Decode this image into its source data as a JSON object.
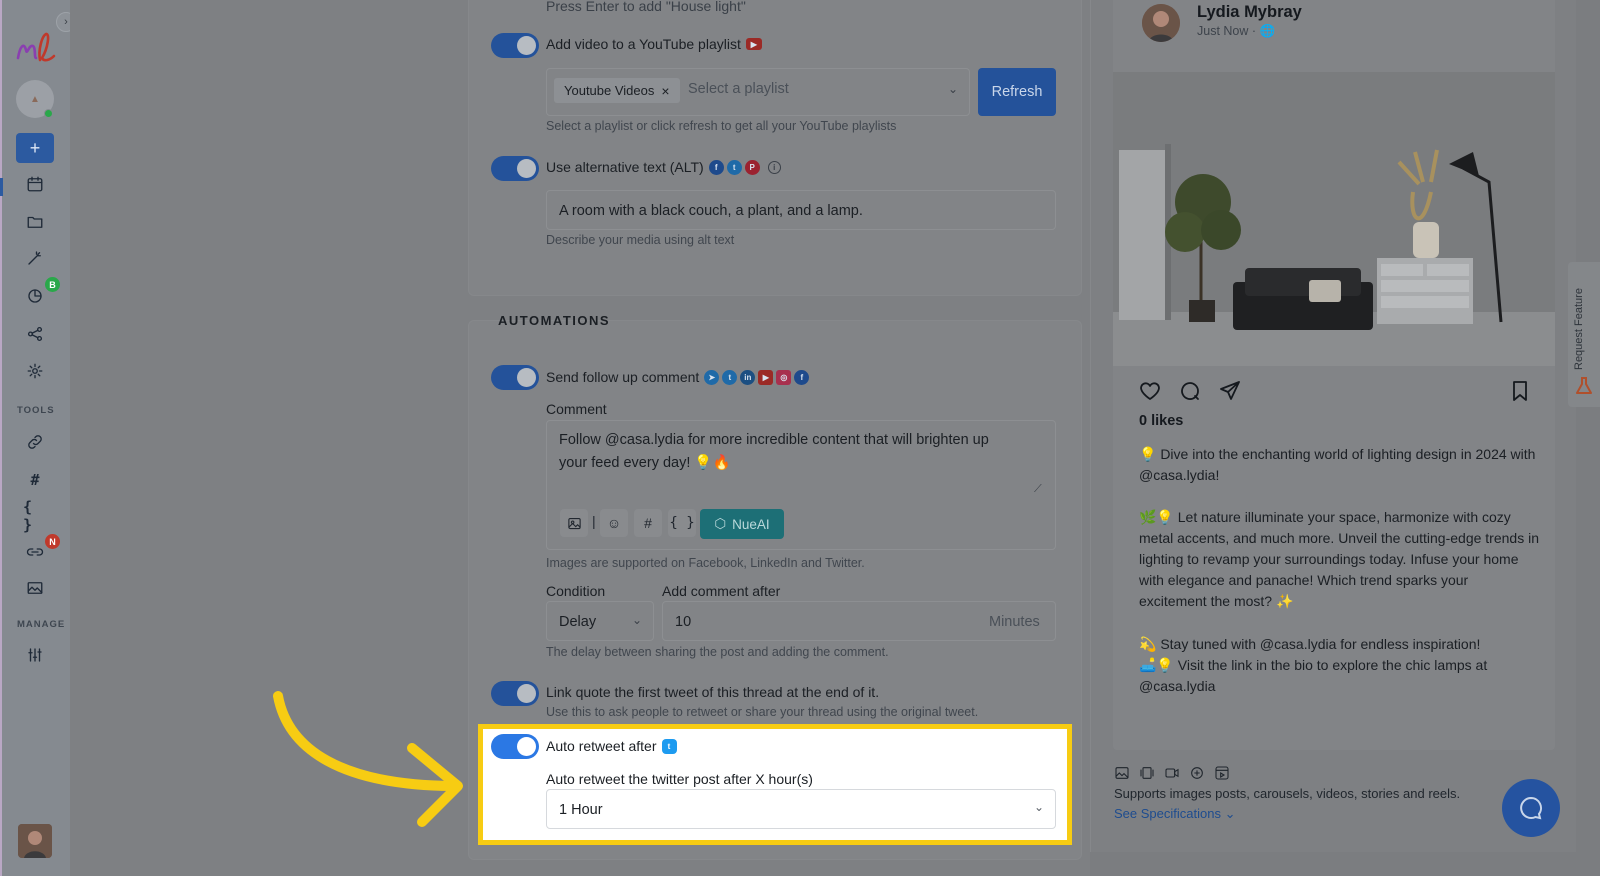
{
  "sidebar": {
    "section_tools": "TOOLS",
    "section_manage": "MANAGE",
    "badge_b": "B",
    "badge_n": "N",
    "logo_text": "nl",
    "icons": [
      "calendar-icon",
      "folder-icon",
      "magic-wand-icon",
      "analytics-icon",
      "share-icon",
      "gear-icon",
      "link-icon",
      "hashtag-icon",
      "braces-icon",
      "shortlink-icon",
      "media-library-icon",
      "sliders-icon"
    ]
  },
  "top_section": {
    "press_enter_hint": "Press Enter to add \"House light\"",
    "youtube_toggle_label": "Add video to a YouTube playlist",
    "playlist_chip": "Youtube Videos",
    "playlist_placeholder": "Select a playlist",
    "refresh_button": "Refresh",
    "playlist_hint": "Select a playlist or click refresh to get all your YouTube playlists",
    "alt_toggle_label": "Use alternative text (ALT)",
    "alt_value": "A room with a black couch, a plant, and a lamp.",
    "alt_hint": "Describe your media using alt text"
  },
  "automations": {
    "title": "AUTOMATIONS",
    "follow_up_label": "Send follow up comment",
    "comment_label": "Comment",
    "comment_line1": "Follow @casa.lydia for more incredible content that will brighten up",
    "comment_line2": "your feed every day! 💡🔥",
    "nueai_button": "NueAI",
    "images_hint": "Images are supported on Facebook, LinkedIn and Twitter.",
    "condition_label": "Condition",
    "add_after_label": "Add comment after",
    "condition_value": "Delay",
    "delay_value": "10",
    "delay_unit": "Minutes",
    "delay_hint": "The delay between sharing the post and adding the comment.",
    "link_quote_label": "Link quote the first tweet of this thread at the end of it.",
    "link_quote_hint": "Use this to ask people to retweet or share your thread using the original tweet.",
    "auto_retweet_label": "Auto retweet after",
    "auto_retweet_sub": "Auto retweet the twitter post after X hour(s)",
    "auto_retweet_value": "1 Hour"
  },
  "preview": {
    "name": "Lydia Mybray",
    "time": "Just Now · ",
    "likes": "0 likes",
    "p1": "💡 Dive into the enchanting world of lighting design in 2024 with @casa.lydia!",
    "p2": "🌿💡 Let nature illuminate your space, harmonize with cozy metal accents, and much more. Unveil the cutting-edge trends in lighting to revamp your surroundings today. Infuse your home with elegance and panache! Which trend sparks your excitement the most? ✨",
    "p3a": "💫 Stay tuned with @casa.lydia for endless inspiration!",
    "p3b": "🛋️💡 Visit the link in the bio to explore the chic lamps at @casa.lydia",
    "support_text": "Supports images posts, carousels, videos, stories and reels.",
    "spec_link": "See Specifications",
    "request_feature": "Request Feature"
  },
  "colors": {
    "highlight_border": "#f7cc13",
    "toggle_active": "#2b78e4",
    "arrow": "#f7cc13"
  }
}
